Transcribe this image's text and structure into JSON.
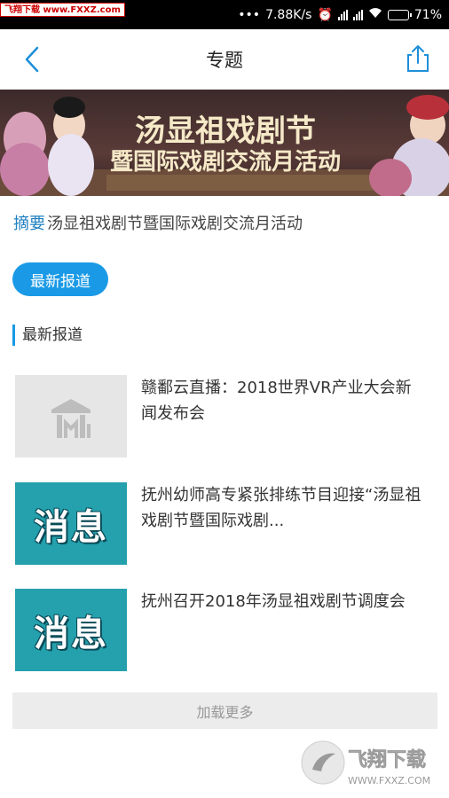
{
  "statusbar": {
    "watermark": "飞翔下载 www.FXXZ.com",
    "net_speed": "7.88K/s",
    "battery": "71%",
    "battery_level": 0.71
  },
  "navbar": {
    "title": "专题"
  },
  "banner": {
    "line1": "汤显祖戏剧节",
    "line2": "暨国际戏剧交流月活动"
  },
  "summary": {
    "label": "摘要",
    "text": "汤显祖戏剧节暨国际戏剧交流月活动"
  },
  "tab_pill": {
    "label": "最新报道"
  },
  "section": {
    "title": "最新报道"
  },
  "news": [
    {
      "title": "赣鄱云直播：2018世界VR产业大会新闻发布会",
      "thumb": "placeholder-logo"
    },
    {
      "title": "抚州幼师高专紧张排练节目迎接“汤显祖戏剧节暨国际戏剧...",
      "thumb_text": "消息"
    },
    {
      "title": "抚州召开2018年汤显祖戏剧节调度会",
      "thumb_text": "消息"
    }
  ],
  "load_more": {
    "label": "加载更多"
  },
  "watermark_bottom": {
    "brand": "飞翔下载",
    "url": "WWW.FXXZ.COM"
  },
  "colors": {
    "accent": "#1a9ae6",
    "teal_thumb": "#25a0ad"
  }
}
